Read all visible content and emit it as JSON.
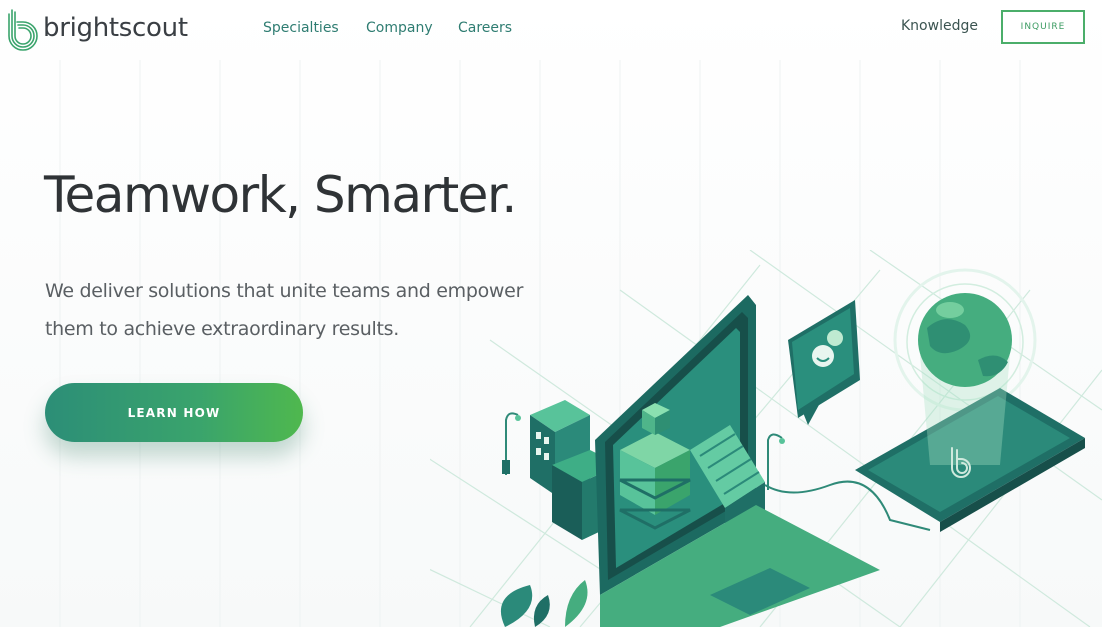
{
  "brand": {
    "name": "brightscout",
    "primary_color": "#2f7d72",
    "accent_color": "#4bae6a"
  },
  "nav": {
    "items": [
      {
        "label": "Specialties"
      },
      {
        "label": "Company"
      },
      {
        "label": "Careers"
      }
    ],
    "knowledge_label": "Knowledge",
    "inquire_label": "INQUIRE"
  },
  "hero": {
    "title": "Teamwork, Smarter.",
    "subtitle": "We deliver solutions that unite teams and empower them to achieve extraordinary results.",
    "cta_label": "LEARN HOW"
  },
  "icons": {
    "logo": "brightscout-logo-icon",
    "illustration": "isometric-office-illustration"
  }
}
